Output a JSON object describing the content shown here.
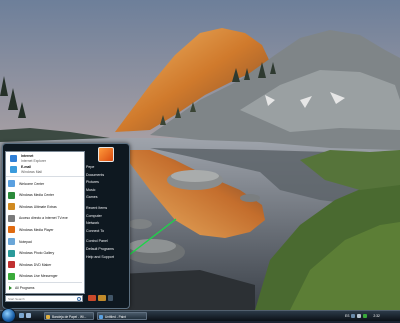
{
  "start_menu": {
    "pinned": [
      {
        "title": "Internet",
        "subtitle": "Internet Explorer",
        "icon": "ie-icon",
        "color": "#2f7fd6"
      },
      {
        "title": "E-mail",
        "subtitle": "Windows Mail",
        "icon": "mail-icon",
        "color": "#3a9bdc"
      }
    ],
    "recent": [
      {
        "label": "Welcome Center",
        "icon": "welcome-center-icon",
        "color": "#5aa0e0"
      },
      {
        "label": "Windows Media Center",
        "icon": "media-center-icon",
        "color": "#2a8a3a"
      },
      {
        "label": "Windows Ultimate Extras",
        "icon": "ultimate-extras-icon",
        "color": "#d08a20"
      },
      {
        "label": "Acceso directo a Internet TV.exe",
        "icon": "tv-shortcut-icon",
        "color": "#7a7a7a"
      },
      {
        "label": "Windows Media Player",
        "icon": "media-player-icon",
        "color": "#e06a10"
      },
      {
        "label": "Notepad",
        "icon": "notepad-icon",
        "color": "#6aa6d8"
      },
      {
        "label": "Windows Photo Gallery",
        "icon": "photo-gallery-icon",
        "color": "#2a9a9a"
      },
      {
        "label": "Windows DVD Maker",
        "icon": "dvd-maker-icon",
        "color": "#c03030"
      },
      {
        "label": "Windows Live Messenger",
        "icon": "messenger-icon",
        "color": "#3aaa3a"
      }
    ],
    "all_programs": "All Programs",
    "search_placeholder": "Start Search",
    "right_links": [
      "Pepe",
      "Documents",
      "Pictures",
      "Music",
      "Games",
      "Recent Items",
      "Computer",
      "Network",
      "Connect To",
      "Control Panel",
      "Default Programs",
      "Help and Support"
    ]
  },
  "taskbar": {
    "buttons": [
      {
        "label": "Bandeja de Papel - Wi...",
        "icon": "folder-icon",
        "color": "#e0b040"
      },
      {
        "label": "Untitled - Paint",
        "icon": "paint-icon",
        "color": "#5aa0e0"
      }
    ],
    "tray": {
      "language": "ES",
      "time": "2:32"
    }
  },
  "colors": {
    "arrow": "#1fd24a",
    "taskbar": "#0b1117"
  }
}
